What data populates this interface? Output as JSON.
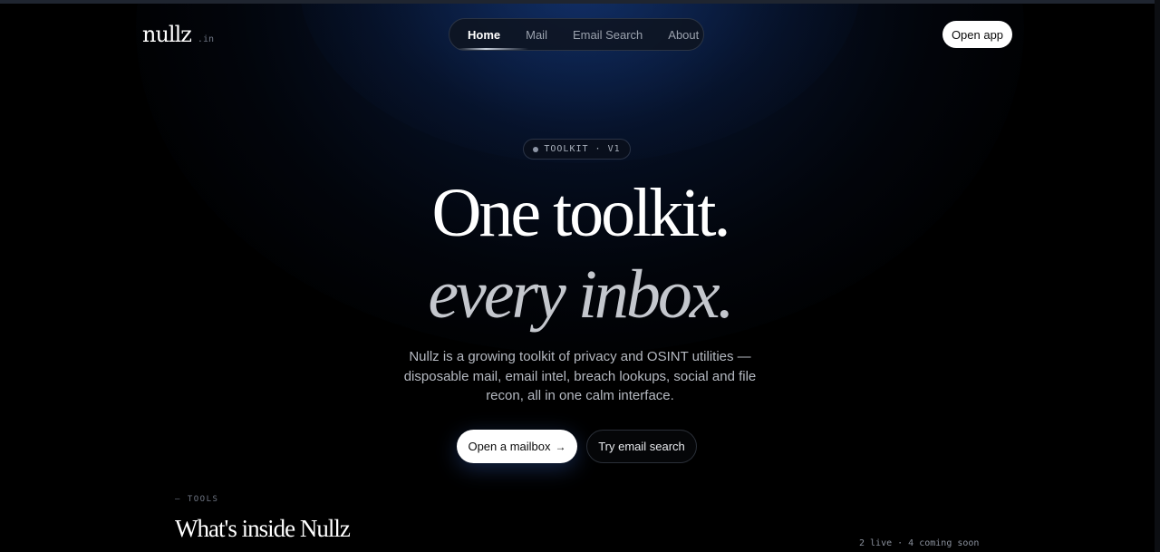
{
  "brand": {
    "name": "nullz",
    "tld": ".in"
  },
  "nav": {
    "items": [
      {
        "label": "Home"
      },
      {
        "label": "Mail"
      },
      {
        "label": "Email Search"
      },
      {
        "label": "About"
      }
    ],
    "active": "Home"
  },
  "header": {
    "open_app_label": "Open app"
  },
  "badge": {
    "text": "TOOLKIT · V1"
  },
  "hero": {
    "line1": "One toolkit.",
    "line2": "every inbox.",
    "description": "Nullz is a growing toolkit of privacy and OSINT utilities — disposable mail, email intel, breach lookups, social and file recon, all in one calm interface."
  },
  "cta": {
    "primary_label": "Open a mailbox",
    "primary_icon": "arrow-right-icon",
    "primary_arrow": "→",
    "secondary_label": "Try email search"
  },
  "tools": {
    "eyebrow": "— TOOLS",
    "title": "What's inside Nullz",
    "status": "2 live · 4 coming soon"
  },
  "colors": {
    "background": "#000000",
    "glow": "#123069",
    "text_primary": "#ffffff",
    "text_muted": "#b6bac2",
    "hero_italic": "#c4c7cd"
  }
}
